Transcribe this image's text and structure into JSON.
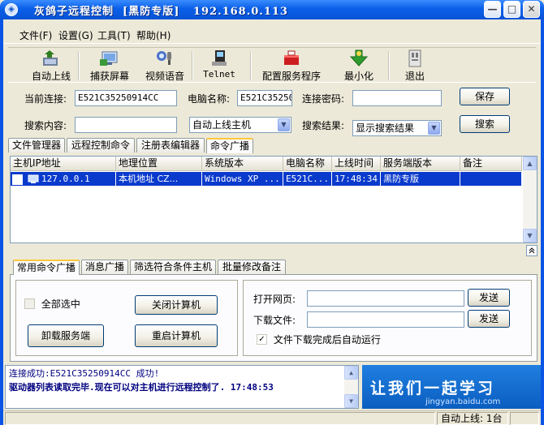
{
  "window": {
    "title": "灰鸽子远程控制  [黑防专版]   192.168.0.113",
    "sys_icon": "◈",
    "min_glyph": "—",
    "max_glyph": "□",
    "close_glyph": "✕"
  },
  "menu": [
    {
      "label": "文件(F)"
    },
    {
      "label": "设置(G)"
    },
    {
      "label": "工具(T)"
    },
    {
      "label": "帮助(H)"
    }
  ],
  "toolbar": [
    {
      "label": "自动上线",
      "icon": "auto-online-icon"
    },
    {
      "label": "捕获屏幕",
      "icon": "capture-screen-icon"
    },
    {
      "label": "视频语音",
      "icon": "video-voice-icon"
    },
    {
      "label": "Telnet",
      "icon": "telnet-icon"
    },
    {
      "label": "配置服务程序",
      "icon": "config-server-icon"
    },
    {
      "label": "最小化",
      "icon": "minimize-icon"
    },
    {
      "label": "退出",
      "icon": "exit-icon"
    }
  ],
  "connection": {
    "current_label": "当前连接:",
    "current_value": "E521C35250914CC",
    "computer_label": "电脑名称:",
    "computer_value": "E521C35250",
    "password_label": "连接密码:",
    "password_value": "",
    "save_label": "保存"
  },
  "search": {
    "content_label": "搜索内容:",
    "content_value": "",
    "mode_value": "自动上线主机",
    "result_label": "搜索结果:",
    "result_value": "显示搜索结果",
    "search_label": "搜索"
  },
  "main_tabs": [
    {
      "label": "文件管理器"
    },
    {
      "label": "远程控制命令"
    },
    {
      "label": "注册表编辑器"
    },
    {
      "label": "命令广播"
    }
  ],
  "grid": {
    "columns": [
      "主机IP地址",
      "地理位置",
      "系统版本",
      "电脑名称",
      "上线时间",
      "服务端版本",
      "备注"
    ],
    "rows": [
      {
        "ip": "127.0.0.1",
        "location": "本机地址  CZ...",
        "os": "Windows XP ...",
        "name": "E521C...",
        "time": "17:48:34",
        "server_version": "黑防专版",
        "note": ""
      }
    ]
  },
  "sub_tabs": [
    {
      "label": "常用命令广播"
    },
    {
      "label": "消息广播"
    },
    {
      "label": "筛选符合条件主机"
    },
    {
      "label": "批量修改备注"
    }
  ],
  "broadcast": {
    "select_all_label": "全部选中",
    "shutdown_label": "关闭计算机",
    "uninstall_label": "卸载服务端",
    "restart_label": "重启计算机",
    "open_url_label": "打开网页:",
    "open_url_value": "",
    "download_label": "下载文件:",
    "download_value": "",
    "send_label": "发送",
    "run_after_download_label": "文件下载完成后自动运行"
  },
  "log": {
    "line1": "连接成功:E521C35250914CC 成功!",
    "line2": "驱动器列表读取完毕.现在可以对主机进行远程控制了.  17:48:53"
  },
  "banner": {
    "text": "让我们一起学习",
    "sub": "jingyan.baidu.com"
  },
  "status": {
    "online_count": "自动上线: 1台"
  }
}
